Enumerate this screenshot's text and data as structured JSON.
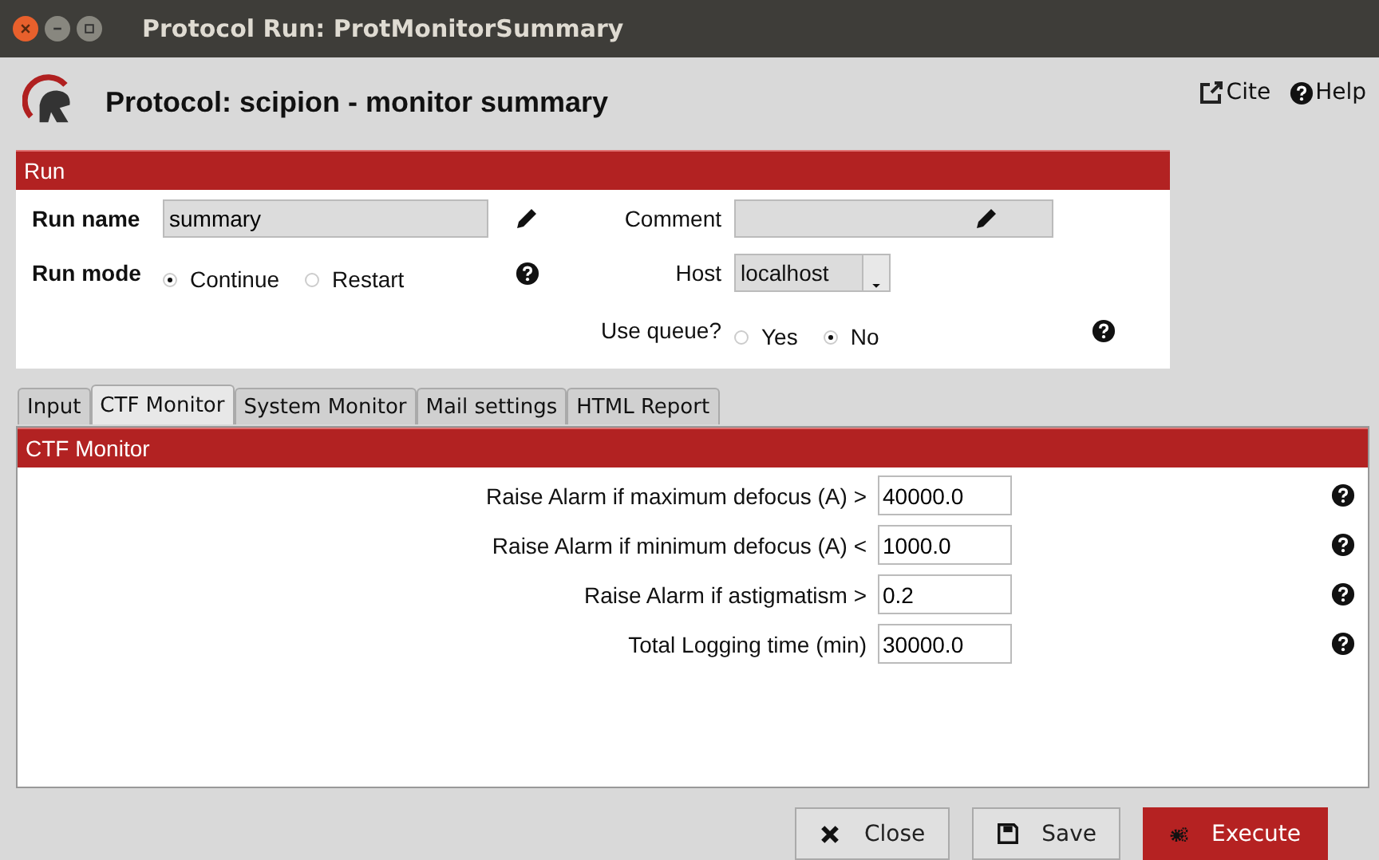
{
  "window": {
    "title": "Protocol Run: ProtMonitorSummary"
  },
  "header": {
    "title": "Protocol: scipion - monitor summary",
    "links": [
      {
        "label": "Cite",
        "kind": "external"
      },
      {
        "label": "Help",
        "kind": "help"
      }
    ]
  },
  "run": {
    "title": "Run",
    "run_name": {
      "label": "Run name",
      "value": "summary"
    },
    "comment": {
      "label": "Comment"
    },
    "run_mode": {
      "label": "Run mode",
      "options": [
        {
          "label": "Continue",
          "selected": true
        },
        {
          "label": "Restart",
          "selected": false
        }
      ]
    },
    "host": {
      "label": "Host",
      "value": "localhost"
    },
    "use_queue": {
      "label": "Use queue?",
      "options": [
        {
          "label": "Yes",
          "selected": false
        },
        {
          "label": "No",
          "selected": true
        }
      ]
    }
  },
  "tabs": [
    {
      "label": "Input",
      "selected": false
    },
    {
      "label": "CTF Monitor",
      "selected": true
    },
    {
      "label": "System Monitor",
      "selected": false
    },
    {
      "label": "Mail settings",
      "selected": false
    },
    {
      "label": "HTML Report",
      "selected": false
    }
  ],
  "panel": {
    "title": "CTF Monitor",
    "params": [
      {
        "label": "Raise Alarm if maximum defocus (A) >",
        "value": "40000.0"
      },
      {
        "label": "Raise Alarm if minimum defocus (A) <",
        "value": "1000.0"
      },
      {
        "label": "Raise Alarm if astigmatism >",
        "value": "0.2"
      },
      {
        "label": "Total Logging time (min)",
        "value": "30000.0"
      }
    ]
  },
  "buttons": [
    {
      "label": "Close",
      "kind": "close"
    },
    {
      "label": "Save",
      "kind": "save"
    },
    {
      "label": "Execute",
      "kind": "execute"
    }
  ]
}
